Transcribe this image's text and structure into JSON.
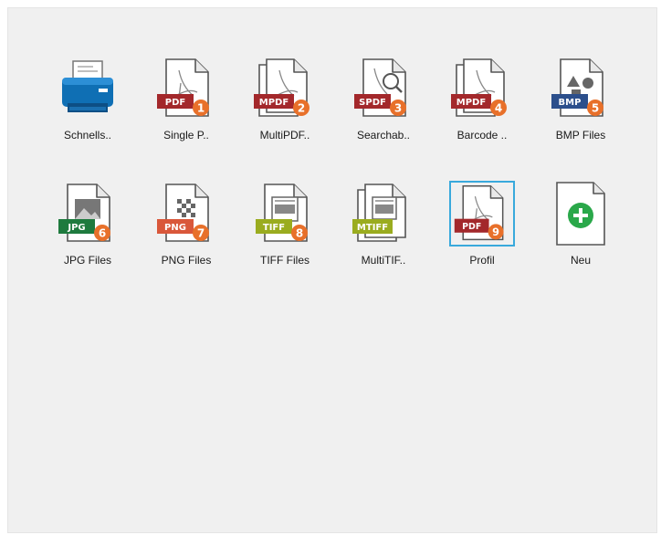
{
  "colors": {
    "panel_bg": "#f0f0f0",
    "pdf_tag": "#a3282b",
    "bmp_tag": "#2c4f8c",
    "jpg_tag": "#1e7a3e",
    "png_tag": "#d9573a",
    "tiff_tag": "#9aac1f",
    "badge": "#e8702a",
    "selection": "#39a9dc",
    "add_green": "#2aa84a"
  },
  "tiles": [
    {
      "label": "Schnells..",
      "icon": "printer-icon"
    },
    {
      "label": "Single P..",
      "icon": "pdf-document-icon",
      "tag": "PDF",
      "badge": "1"
    },
    {
      "label": "MultiPDF..",
      "icon": "multi-pdf-document-icon",
      "tag": "MPDF",
      "badge": "2"
    },
    {
      "label": "Searchab..",
      "icon": "searchable-pdf-icon",
      "tag": "SPDF",
      "badge": "3"
    },
    {
      "label": "Barcode ..",
      "icon": "barcode-multi-pdf-icon",
      "tag": "MPDF",
      "badge": "4"
    },
    {
      "label": "BMP Files",
      "icon": "bmp-file-icon",
      "tag": "BMP",
      "badge": "5"
    },
    {
      "label": "JPG Files",
      "icon": "jpg-file-icon",
      "tag": "JPG",
      "badge": "6"
    },
    {
      "label": "PNG Files",
      "icon": "png-file-icon",
      "tag": "PNG",
      "badge": "7"
    },
    {
      "label": "TIFF Files",
      "icon": "tiff-file-icon",
      "tag": "TIFF",
      "badge": "8"
    },
    {
      "label": "MultiTIF..",
      "icon": "multi-tiff-file-icon",
      "tag": "MTIFF"
    },
    {
      "label": "Profil",
      "icon": "pdf-profile-icon",
      "tag": "PDF",
      "badge": "9",
      "selected": true
    },
    {
      "label": "Neu",
      "icon": "add-new-icon"
    }
  ]
}
